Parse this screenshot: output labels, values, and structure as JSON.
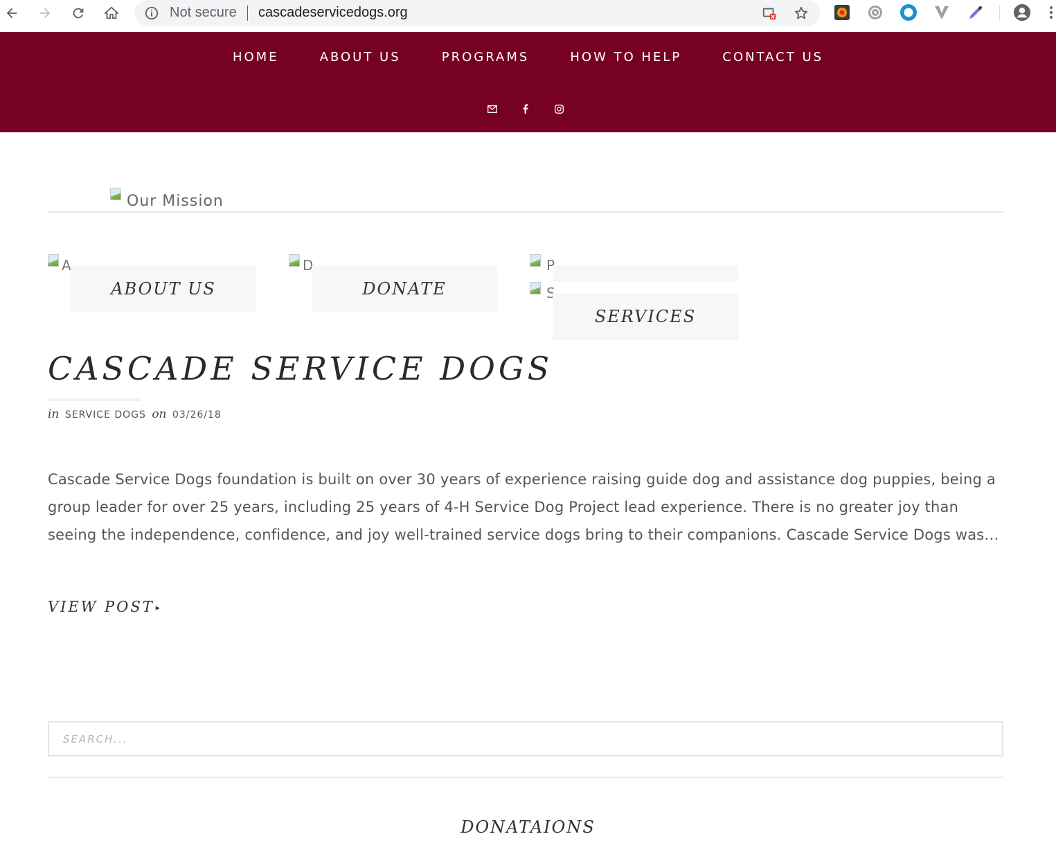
{
  "browser": {
    "security_label": "Not secure",
    "url": "cascadeservicedogs.org"
  },
  "nav": {
    "items": [
      "HOME",
      "ABOUT US",
      "PROGRAMS",
      "HOW TO HELP",
      "CONTACT US"
    ],
    "social_icons": [
      "mail-icon",
      "facebook-icon",
      "instagram-icon"
    ],
    "header_color": "#770025"
  },
  "mission": {
    "alt_text": "Our Mission"
  },
  "features": {
    "about": {
      "alt_fragment": "A",
      "label": "ABOUT US"
    },
    "donate": {
      "alt_fragment": "D",
      "label": "DONATE"
    },
    "first_third": {
      "alt_fragment": "P"
    },
    "services": {
      "alt_fragment": "S",
      "label": "SERVICES"
    }
  },
  "post": {
    "title": "CASCADE SERVICE DOGS",
    "meta_in": "in",
    "category": "SERVICE DOGS",
    "meta_on": "on",
    "date": "03/26/18",
    "excerpt": "Cascade Service Dogs foundation is built on over 30 years of experience raising guide dog and assistance dog puppies, being a group leader for over 25 years, including 25 years of 4-H Service Dog Project lead experience. There is no greater joy than seeing the independence, confidence, and joy well-trained service dogs bring to their companions. Cascade Service Dogs was…",
    "view_post": "VIEW POST"
  },
  "search": {
    "placeholder": "SEARCH..."
  },
  "footer": {
    "widget_title": "DONATAIONS"
  }
}
